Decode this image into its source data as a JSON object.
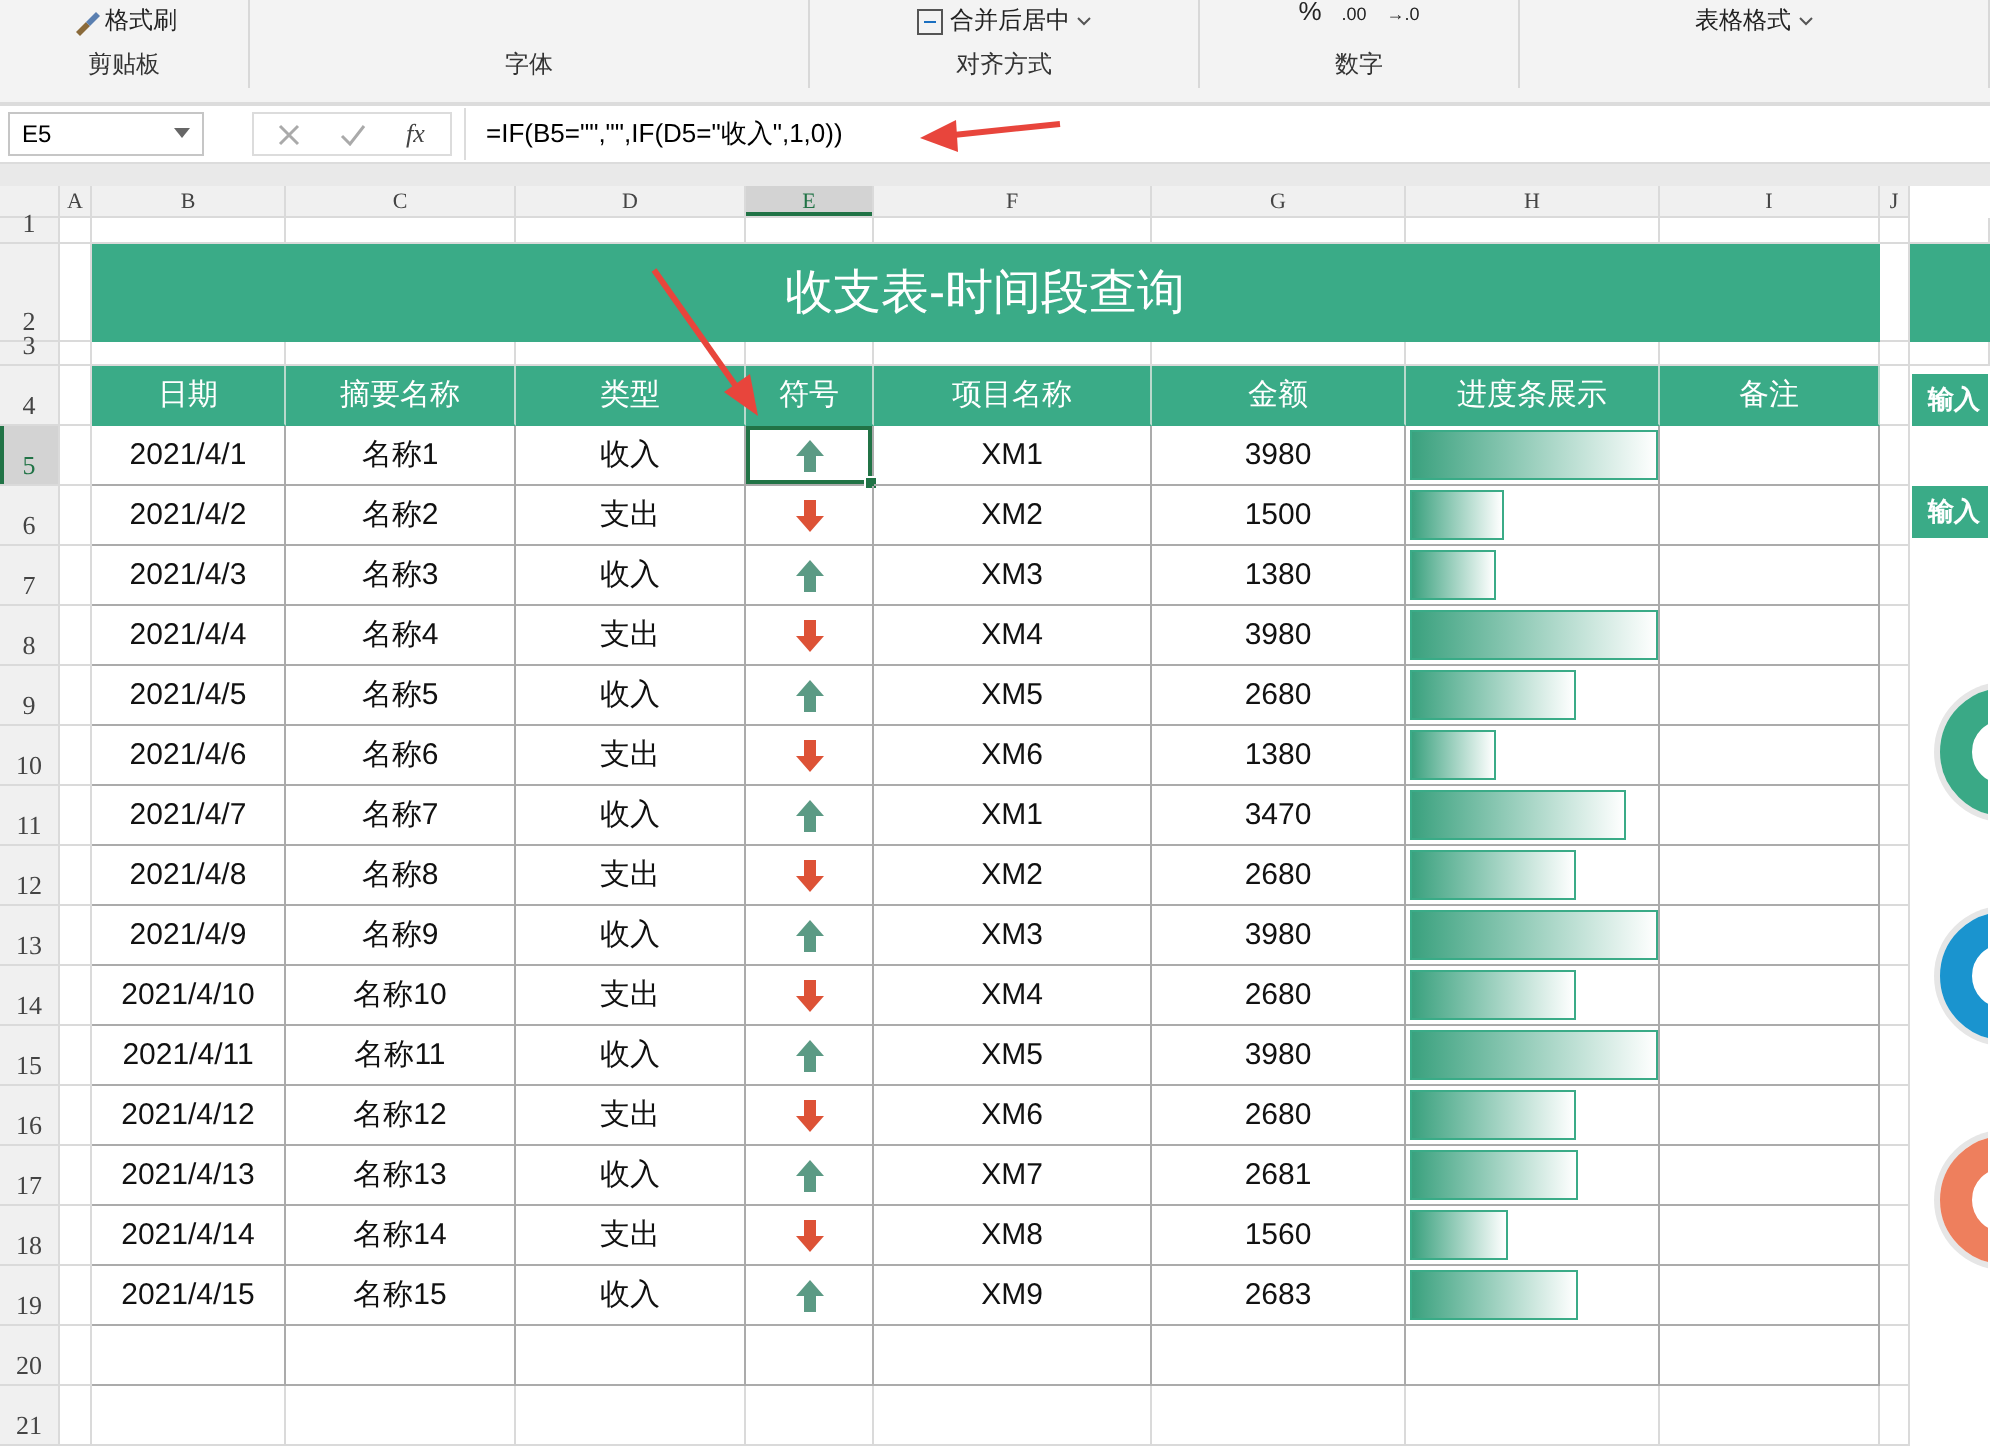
{
  "ribbon": {
    "buttons": [
      {
        "kind": "brush",
        "label": "格式刷"
      },
      {
        "kind": "merge",
        "label": "合并后居中"
      },
      {
        "kind": "text",
        "label": "%"
      },
      {
        "kind": "text",
        "label": ".00"
      },
      {
        "kind": "text",
        "label": "→.0"
      },
      {
        "kind": "dropdown",
        "label": "表格格式"
      }
    ],
    "groups": [
      "剪贴板",
      "字体",
      "对齐方式",
      "数字"
    ]
  },
  "formula_bar": {
    "name_box": "E5",
    "fx": "fx",
    "formula": "=IF(B5=\"\",\"\",IF(D5=\"收入\",1,0))"
  },
  "column_headers": [
    {
      "label": "A",
      "selected": false
    },
    {
      "label": "B",
      "selected": false
    },
    {
      "label": "C",
      "selected": false
    },
    {
      "label": "D",
      "selected": false
    },
    {
      "label": "E",
      "selected": true
    },
    {
      "label": "F",
      "selected": false
    },
    {
      "label": "G",
      "selected": false
    },
    {
      "label": "H",
      "selected": false
    },
    {
      "label": "I",
      "selected": false
    },
    {
      "label": "J",
      "selected": false
    }
  ],
  "row_headers": [
    {
      "label": "1",
      "selected": false
    },
    {
      "label": "2",
      "selected": false
    },
    {
      "label": "3",
      "selected": false
    },
    {
      "label": "4",
      "selected": false
    },
    {
      "label": "5",
      "selected": true
    },
    {
      "label": "6",
      "selected": false
    },
    {
      "label": "7",
      "selected": false
    },
    {
      "label": "8",
      "selected": false
    },
    {
      "label": "9",
      "selected": false
    },
    {
      "label": "10",
      "selected": false
    },
    {
      "label": "11",
      "selected": false
    },
    {
      "label": "12",
      "selected": false
    },
    {
      "label": "13",
      "selected": false
    },
    {
      "label": "14",
      "selected": false
    },
    {
      "label": "15",
      "selected": false
    },
    {
      "label": "16",
      "selected": false
    },
    {
      "label": "17",
      "selected": false
    },
    {
      "label": "18",
      "selected": false
    },
    {
      "label": "19",
      "selected": false
    },
    {
      "label": "20",
      "selected": false
    },
    {
      "label": "21",
      "selected": false
    }
  ],
  "sheet": {
    "title": "收支表-时间段查询",
    "headers": [
      "日期",
      "摘要名称",
      "类型",
      "符号",
      "项目名称",
      "金额",
      "进度条展示",
      "备注"
    ],
    "rows": [
      {
        "date": "2021/4/1",
        "name": "名称1",
        "type": "收入",
        "kind": "up",
        "selected": true,
        "item": "XM1",
        "amount": "3980",
        "level": 1
      },
      {
        "date": "2021/4/2",
        "name": "名称2",
        "type": "支出",
        "kind": "down",
        "selected": false,
        "item": "XM2",
        "amount": "1500",
        "level": 0.377
      },
      {
        "date": "2021/4/3",
        "name": "名称3",
        "type": "收入",
        "kind": "up",
        "selected": false,
        "item": "XM3",
        "amount": "1380",
        "level": 0.347
      },
      {
        "date": "2021/4/4",
        "name": "名称4",
        "type": "支出",
        "kind": "down",
        "selected": false,
        "item": "XM4",
        "amount": "3980",
        "level": 1
      },
      {
        "date": "2021/4/5",
        "name": "名称5",
        "type": "收入",
        "kind": "up",
        "selected": false,
        "item": "XM5",
        "amount": "2680",
        "level": 0.673
      },
      {
        "date": "2021/4/6",
        "name": "名称6",
        "type": "支出",
        "kind": "down",
        "selected": false,
        "item": "XM6",
        "amount": "1380",
        "level": 0.347
      },
      {
        "date": "2021/4/7",
        "name": "名称7",
        "type": "收入",
        "kind": "up",
        "selected": false,
        "item": "XM1",
        "amount": "3470",
        "level": 0.872
      },
      {
        "date": "2021/4/8",
        "name": "名称8",
        "type": "支出",
        "kind": "down",
        "selected": false,
        "item": "XM2",
        "amount": "2680",
        "level": 0.673
      },
      {
        "date": "2021/4/9",
        "name": "名称9",
        "type": "收入",
        "kind": "up",
        "selected": false,
        "item": "XM3",
        "amount": "3980",
        "level": 1
      },
      {
        "date": "2021/4/10",
        "name": "名称10",
        "type": "支出",
        "kind": "down",
        "selected": false,
        "item": "XM4",
        "amount": "2680",
        "level": 0.673
      },
      {
        "date": "2021/4/11",
        "name": "名称11",
        "type": "收入",
        "kind": "up",
        "selected": false,
        "item": "XM5",
        "amount": "3980",
        "level": 1
      },
      {
        "date": "2021/4/12",
        "name": "名称12",
        "type": "支出",
        "kind": "down",
        "selected": false,
        "item": "XM6",
        "amount": "2680",
        "level": 0.673
      },
      {
        "date": "2021/4/13",
        "name": "名称13",
        "type": "收入",
        "kind": "up",
        "selected": false,
        "item": "XM7",
        "amount": "2681",
        "level": 0.674
      },
      {
        "date": "2021/4/14",
        "name": "名称14",
        "type": "支出",
        "kind": "down",
        "selected": false,
        "item": "XM8",
        "amount": "1560",
        "level": 0.392
      },
      {
        "date": "2021/4/15",
        "name": "名称15",
        "type": "收入",
        "kind": "up",
        "selected": false,
        "item": "XM9",
        "amount": "2683",
        "level": 0.674
      }
    ]
  },
  "side_panel": {
    "labels": [
      "输入",
      "输入"
    ],
    "rings": [
      {
        "color": "#3aa986"
      },
      {
        "color": "#1a94cf"
      },
      {
        "color": "#ee7f5d"
      }
    ]
  }
}
